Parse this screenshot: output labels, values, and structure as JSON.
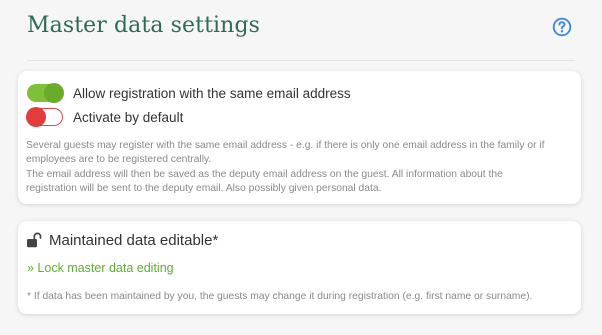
{
  "page": {
    "title": "Master data settings",
    "help_icon": "question-circle-icon",
    "accent_color": "#2e6b57"
  },
  "registration_card": {
    "toggles": [
      {
        "label": "Allow registration with the same email address",
        "state": "on",
        "color": "#7fbf3a"
      },
      {
        "label": "Activate by default",
        "state": "off",
        "color": "#e43c3c"
      }
    ],
    "description_lines": [
      "Several guests may register with the same email address - e.g. if there is only one email address in the family or if",
      "employees are to be registered centrally.",
      "The email address will then be saved as the deputy email address on the guest. All information about the",
      "registration will be sent to the deputy email. Also possibly given personal data."
    ]
  },
  "maintained_card": {
    "icon": "unlock-icon",
    "title": "Maintained data editable*",
    "link_label": "» Lock master data editing",
    "link_color": "#5db12f",
    "note": "* If data has been maintained by you, the guests may change it during registration (e.g. first name or surname)."
  }
}
